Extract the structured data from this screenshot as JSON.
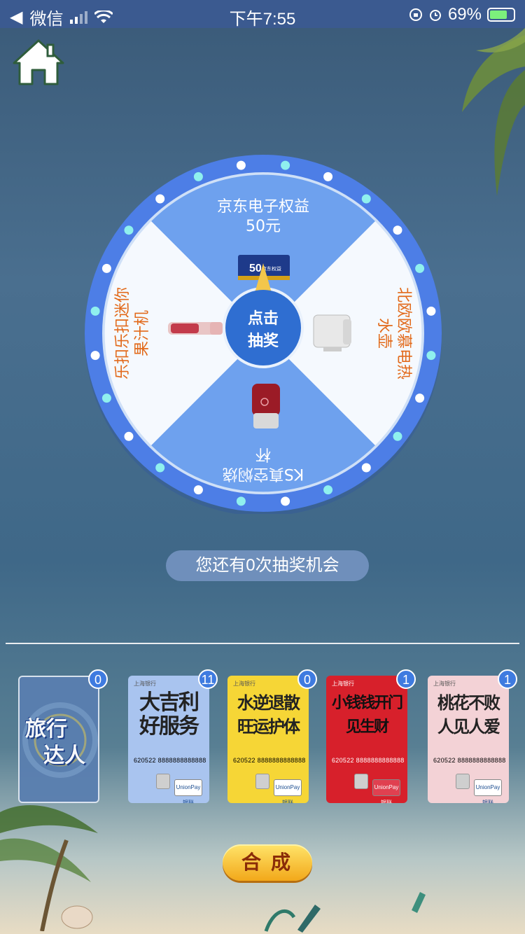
{
  "status_bar": {
    "back_app": "微信",
    "time": "下午7:55",
    "battery_percent": "69%"
  },
  "wheel": {
    "center_button": [
      "点击",
      "抽奖"
    ],
    "prizes": [
      {
        "name": "京东电子权益",
        "sub": "50元",
        "voucher_amount": "50",
        "voucher_text": "京东权益"
      },
      {
        "name": "北欧欧慕电热",
        "sub": "水壶"
      },
      {
        "name": "KS真空焖烧",
        "sub": "杯"
      },
      {
        "name": "乐扣乐扣迷你",
        "sub": "果汁机"
      }
    ]
  },
  "chances_text": "您还有0次抽奖机会",
  "cards": [
    {
      "id": "travel",
      "title": [
        "旅行",
        "达人"
      ],
      "count": "0",
      "bg": "#5a7fb0"
    },
    {
      "id": "jili",
      "bank": "上海银行",
      "calli": "大吉利\n好服务",
      "number": "620522 8888888888888",
      "count": "11",
      "bg": "#a9c4ef",
      "ink": "#222"
    },
    {
      "id": "wangyun",
      "bank": "上海银行",
      "calli": "水逆退散\n旺运护体",
      "number": "620522 8888888888888",
      "count": "0",
      "bg": "#f6d636",
      "ink": "#222"
    },
    {
      "id": "facai",
      "bank": "上海银行",
      "calli": "小钱钱开门\n见生财",
      "number": "620522 8888888888888",
      "count": "1",
      "bg": "#d7202b",
      "ink": "#111"
    },
    {
      "id": "taohua",
      "bank": "上海银行",
      "calli": "桃花不败\n人见人爱",
      "number": "620522 8888888888888",
      "count": "1",
      "bg": "#f3d2d6",
      "ink": "#222"
    }
  ],
  "union_pay": "UnionPay 银联",
  "synthesize_button": "合成",
  "colors": {
    "wheel_blue": "#5b8ee8",
    "wheel_light": "#eaf2fb",
    "prize_text": "#e26a1b",
    "center": "#2f6ed1"
  }
}
